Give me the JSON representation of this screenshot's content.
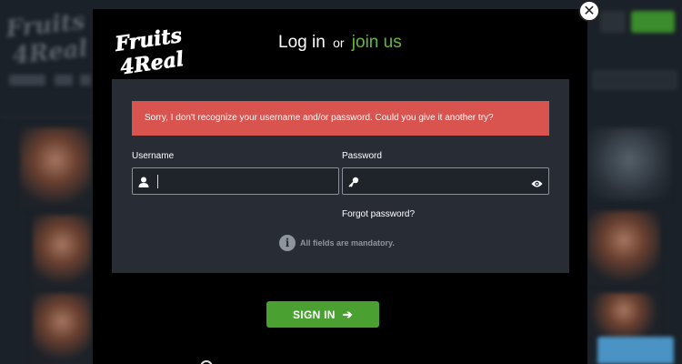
{
  "background": {
    "logo_text": "Fruits 4Real"
  },
  "modal": {
    "logo_text": "Fruits 4Real",
    "title_login": "Log in",
    "title_or": "or",
    "title_join": "join us",
    "close_icon": "close-icon",
    "error_message": "Sorry, I don't recognize your username and/or password. Could you give it another try?",
    "username": {
      "label": "Username",
      "value": "",
      "icon": "user-icon"
    },
    "password": {
      "label": "Password",
      "value": "",
      "icon": "key-icon",
      "toggle_icon": "eye-icon"
    },
    "forgot_password": "Forgot password?",
    "mandatory_note": "All fields are mandatory.",
    "signin_label": "SIGN IN",
    "signin_icon": "arrow-right-icon"
  },
  "colors": {
    "accent_green": "#4aa132",
    "join_green": "#6ab63b",
    "error_red": "#d9534f",
    "panel": "#282d35"
  }
}
